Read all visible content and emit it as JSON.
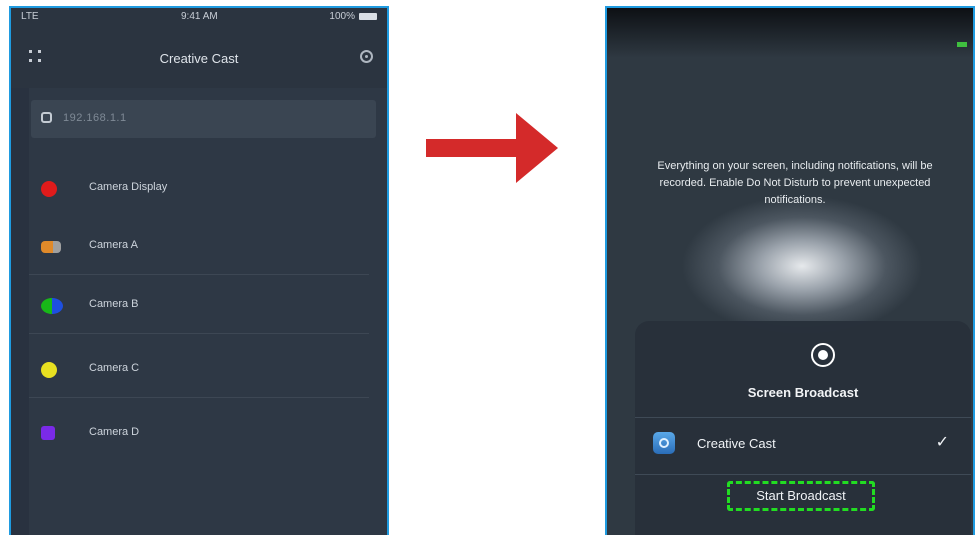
{
  "colors": {
    "frame_border": "#1f9be0",
    "arrow": "#d42a2a",
    "highlight": "#22dd22"
  },
  "left_screen": {
    "status": {
      "signal": "LTE",
      "time": "9:41 AM",
      "battery": "100%"
    },
    "nav": {
      "title": "Creative Cast",
      "menu_icon": "grid-icon",
      "settings_icon": "gear-icon"
    },
    "ip_field": {
      "icon": "link-icon",
      "value": "192.168.1.1"
    },
    "cameras": [
      {
        "label": "Camera Display",
        "color": "#e01b1b",
        "secondary": ""
      },
      {
        "label": "Camera A",
        "color": "#e08a2a",
        "secondary": "#a0a0a0"
      },
      {
        "label": "Camera B",
        "color": "#18b818",
        "secondary": "#1d4fe0"
      },
      {
        "label": "Camera C",
        "color": "#e8e021",
        "secondary": ""
      },
      {
        "label": "Camera D",
        "color": "#7a2ae8",
        "secondary": ""
      }
    ]
  },
  "right_screen": {
    "message": "Everything on your screen, including notifications, will be recorded. Enable Do Not Disturb to prevent unexpected notifications.",
    "sheet_title": "Screen Broadcast",
    "app_label": "Creative Cast",
    "check": "✓",
    "start_button": "Start Broadcast"
  }
}
